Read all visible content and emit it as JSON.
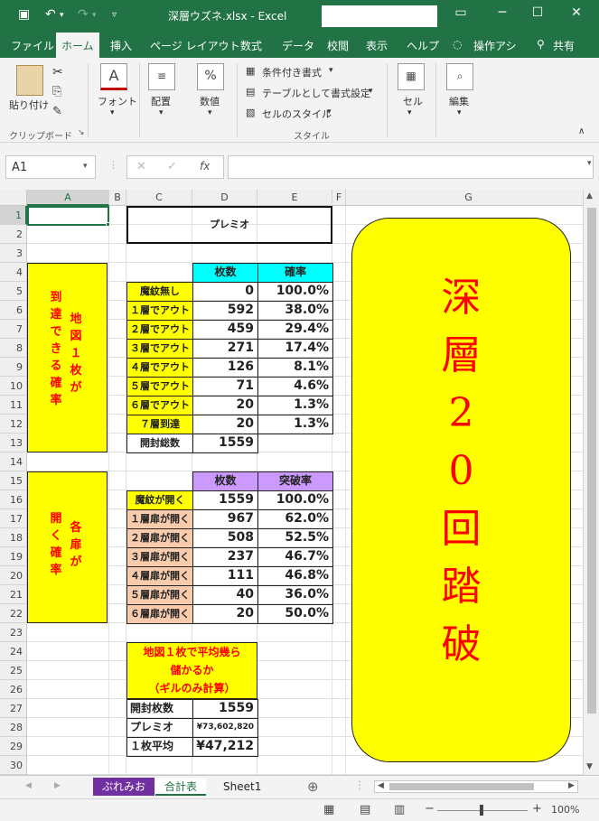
{
  "app": {
    "window_title": "深層ウズネ.xlsx  -  Excel",
    "min": "─",
    "max": "☐",
    "close": "✕"
  },
  "ribbon_tabs": [
    "ファイル",
    "ホーム",
    "挿入",
    "ページ レイアウト",
    "数式",
    "データ",
    "校閲",
    "表示",
    "ヘルプ",
    "操作アシ",
    "共有"
  ],
  "ribbon": {
    "paste": "貼り付け",
    "clipboard": "クリップボード",
    "font": "フォント",
    "align": "配置",
    "number": "数値",
    "cond_format": "条件付き書式",
    "table_format": "テーブルとして書式設定",
    "cell_style": "セルのスタイル",
    "styles": "スタイル",
    "cells": "セル",
    "edit": "編集"
  },
  "formula_bar": {
    "name_box": "A1",
    "fx": "fx",
    "value": ""
  },
  "columns": [
    "A",
    "B",
    "C",
    "D",
    "E",
    "F",
    "G"
  ],
  "rows": [
    "1",
    "2",
    "3",
    "4",
    "5",
    "6",
    "7",
    "8",
    "9",
    "10",
    "11",
    "12",
    "13",
    "14",
    "15",
    "16",
    "17",
    "18",
    "19",
    "20",
    "21",
    "22",
    "23",
    "24",
    "25",
    "26",
    "27",
    "28",
    "29",
    "30"
  ],
  "sheet": {
    "title_cell": "プレミオ",
    "table1": {
      "headers": [
        "枚数",
        "確率"
      ],
      "rows": [
        {
          "label": "魔紋無し",
          "count": "0",
          "rate": "100.0%"
        },
        {
          "label": "１層でアウト",
          "count": "592",
          "rate": "38.0%"
        },
        {
          "label": "２層でアウト",
          "count": "459",
          "rate": "29.4%"
        },
        {
          "label": "３層でアウト",
          "count": "271",
          "rate": "17.4%"
        },
        {
          "label": "４層でアウト",
          "count": "126",
          "rate": "8.1%"
        },
        {
          "label": "５層でアウト",
          "count": "71",
          "rate": "4.6%"
        },
        {
          "label": "６層でアウト",
          "count": "20",
          "rate": "1.3%"
        },
        {
          "label": "７層到達",
          "count": "20",
          "rate": "1.3%"
        }
      ],
      "total_label": "開封総数",
      "total_value": "1559"
    },
    "table2": {
      "headers": [
        "枚数",
        "突破率"
      ],
      "rows": [
        {
          "label": "魔紋が開く",
          "count": "1559",
          "rate": "100.0%"
        },
        {
          "label": "１層扉が開く",
          "count": "967",
          "rate": "62.0%"
        },
        {
          "label": "２層扉が開く",
          "count": "508",
          "rate": "52.5%"
        },
        {
          "label": "３層扉が開く",
          "count": "237",
          "rate": "46.7%"
        },
        {
          "label": "４層扉が開く",
          "count": "111",
          "rate": "46.8%"
        },
        {
          "label": "５層扉が開く",
          "count": "40",
          "rate": "36.0%"
        },
        {
          "label": "６層扉が開く",
          "count": "20",
          "rate": "50.0%"
        }
      ]
    },
    "box1_cols": [
      "地図１枚が",
      "到達できる確率"
    ],
    "box2_cols": [
      "各扉が",
      "開く確率"
    ],
    "summary": {
      "header": [
        "地図１枚で平均幾ら",
        "儲かるか",
        "（ギルのみ計算）"
      ],
      "rows": [
        {
          "label": "開封枚数",
          "value": "1559"
        },
        {
          "label": "プレミオ",
          "value": "¥73,602,820"
        },
        {
          "label": "１枚平均",
          "value": "¥47,212"
        }
      ]
    },
    "banner": [
      "深",
      "層",
      "2",
      "0",
      "回",
      "踏",
      "破"
    ]
  },
  "sheet_tabs": [
    "ぷれみお",
    "合計表",
    "Sheet1"
  ],
  "status": {
    "zoom": "100%"
  },
  "colors": {
    "excel_green": "#217346",
    "cyan": "#00ffff",
    "yellow": "#ffff00",
    "lavender": "#cc99ff",
    "peach": "#f8cbad",
    "red": "#ff0000"
  }
}
